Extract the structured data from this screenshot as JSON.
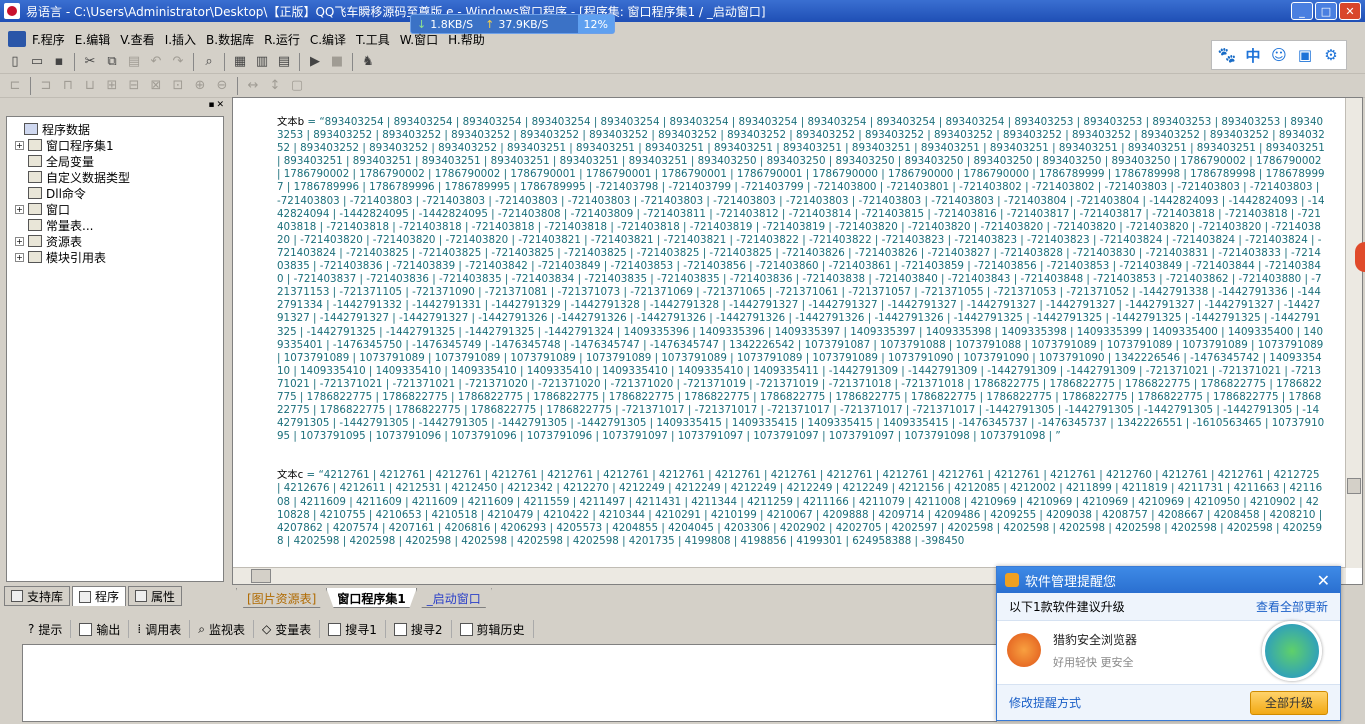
{
  "window": {
    "title": "易语言 - C:\\Users\\Administrator\\Desktop\\【正版】QQ飞车瞬移源码至尊版.e - Windows窗口程序 - [程序集: 窗口程序集1 / _启动窗口]",
    "min": "_",
    "max": "□",
    "close": "✕"
  },
  "netspeed": {
    "down": "1.8KB/S",
    "up": "37.9KB/S",
    "percent": "12%"
  },
  "menu": [
    "F.程序",
    "E.编辑",
    "V.查看",
    "I.插入",
    "B.数据库",
    "R.运行",
    "C.编译",
    "T.工具",
    "W.窗口",
    "H.帮助"
  ],
  "right_icons": [
    "paw-icon",
    "zh-icon",
    "smile-icon",
    "image-icon",
    "gear-icon"
  ],
  "right_icon_glyphs": [
    "🐾",
    "中",
    "☺",
    "▣",
    "⚙"
  ],
  "tree": {
    "items": [
      {
        "label": "程序数据",
        "level": 0,
        "expander": ""
      },
      {
        "label": "窗口程序集1",
        "level": 1,
        "expander": "+"
      },
      {
        "label": "全局变量",
        "level": 1,
        "expander": ""
      },
      {
        "label": "自定义数据类型",
        "level": 1,
        "expander": ""
      },
      {
        "label": "Dll命令",
        "level": 1,
        "expander": ""
      },
      {
        "label": "窗口",
        "level": 1,
        "expander": "+"
      },
      {
        "label": "常量表...",
        "level": 1,
        "expander": ""
      },
      {
        "label": "资源表",
        "level": 1,
        "expander": "+"
      },
      {
        "label": "模块引用表",
        "level": 1,
        "expander": "+"
      }
    ]
  },
  "left_tabs": [
    "支持库",
    "程序",
    "属性"
  ],
  "code": {
    "block_b_label": "文本b",
    "block_b": "= “893403254 | 893403254 | 893403254 | 893403254 | 893403254 | 893403254 | 893403254 | 893403254 | 893403254 | 893403254 | 893403253 | 893403253 | 893403253 | 893403253 | 893403253 | 893403252 | 893403252 | 893403252 | 893403252 | 893403252 | 893403252 | 893403252 | 893403252 | 893403252 | 893403252 | 893403252 | 893403252 | 893403252 | 893403252 | 893403252 | 893403252 | 893403252 | 893403252 | 893403251 | 893403251 | 893403251 | 893403251 | 893403251 | 893403251 | 893403251 | 893403251 | 893403251 | 893403251 | 893403251 | 893403251 | 893403251 | 893403251 | 893403251 | 893403251 | 893403251 | 893403251 | 893403250 | 893403250 | 893403250 | 893403250 | 893403250 | 893403250 | 893403250 | 1786790002 | 1786790002 | 1786790002 | 1786790002 | 1786790002 | 1786790001 | 1786790001 | 1786790001 | 1786790001 | 1786790000 | 1786790000 | 1786790000 | 1786789999 | 1786789998 | 1786789998 | 1786789997 | 1786789996 | 1786789996 | 1786789995 | 1786789995 | -721403798 | -721403799 | -721403799 | -721403800 | -721403801 | -721403802 | -721403802 | -721403803 | -721403803 | -721403803 | -721403803 | -721403803 | -721403803 | -721403803 | -721403803 | -721403803 | -721403803 | -721403803 | -721403803 | -721403803 | -721403804 | -721403804 | -1442824093 | -1442824093 | -1442824094 | -1442824095 | -1442824095 | -721403808 | -721403809 | -721403811 | -721403812 | -721403814 | -721403815 | -721403816 | -721403817 | -721403817 | -721403818 | -721403818 | -721403818 | -721403818 | -721403818 | -721403818 | -721403818 | -721403818 | -721403819 | -721403819 | -721403820 | -721403820 | -721403820 | -721403820 | -721403820 | -721403820 | -721403820 | -721403820 | -721403820 | -721403820 | -721403821 | -721403821 | -721403821 | -721403822 | -721403822 | -721403823 | -721403823 | -721403823 | -721403824 | -721403824 | -721403824 | -721403824 | -721403825 | -721403825 | -721403825 | -721403825 | -721403825 | -721403825 | -721403826 | -721403826 | -721403827 | -721403828 | -721403830 | -721403831 | -721403833 | -721403835 | -721403836 | -721403839 | -721403842 | -721403849 | -721403853 | -721403856 | -721403860 | -721403861 | -721403859 | -721403856 | -721403853 | -721403849 | -721403844 | -721403840 | -721403837 | -721403836 | -721403835 | -721403834 | -721403835 | -721403835 | -721403836 | -721403838 | -721403840 | -721403843 | -721403848 | -721403853 | -721403862 | -721403880 | -721371153 | -721371105 | -721371090 | -721371081 | -721371073 | -721371069 | -721371065 | -721371061 | -721371057 | -721371055 | -721371053 | -721371052 | -1442791338 | -1442791336 | -1442791334 | -1442791332 | -1442791331 | -1442791329 | -1442791328 | -1442791328 | -1442791327 | -1442791327 | -1442791327 | -1442791327 | -1442791327 | -1442791327 | -1442791327 | -1442791327 | -1442791327 | -1442791327 | -1442791326 | -1442791326 | -1442791326 | -1442791326 | -1442791326 | -1442791326 | -1442791325 | -1442791325 | -1442791325 | -1442791325 | -1442791325 | -1442791325 | -1442791325 | -1442791325 | -1442791324 | 1409335396 | 1409335396 | 1409335397 | 1409335397 | 1409335398 | 1409335398 | 1409335399 | 1409335400 | 1409335400 | 1409335401 | -1476345750 | -1476345749 | -1476345748 | -1476345747 | -1476345747 | 1342226542 | 1073791087 | 1073791088 | 1073791088 | 1073791089 | 1073791089 | 1073791089 | 1073791089 | 1073791089 | 1073791089 | 1073791089 | 1073791089 | 1073791089 | 1073791089 | 1073791089 | 1073791089 | 1073791090 | 1073791090 | 1073791090 | 1342226546 | -1476345742 | 1409335410 | 1409335410 | 1409335410 | 1409335410 | 1409335410 | 1409335410 | 1409335410 | 1409335411 | -1442791309 | -1442791309 | -1442791309 | -1442791309 | -721371021 | -721371021 | -721371021 | -721371021 | -721371021 | -721371020 | -721371020 | -721371020 | -721371019 | -721371019 | -721371018 | -721371018 | 1786822775 | 1786822775 | 1786822775 | 1786822775 | 1786822775 | 1786822775 | 1786822775 | 1786822775 | 1786822775 | 1786822775 | 1786822775 | 1786822775 | 1786822775 | 1786822775 | 1786822775 | 1786822775 | 1786822775 | 1786822775 | 1786822775 | 1786822775 | 1786822775 | 1786822775 | 1786822775 | -721371017 | -721371017 | -721371017 | -721371017 | -721371017 | -1442791305 | -1442791305 | -1442791305 | -1442791305 | -1442791305 | -1442791305 | -1442791305 | -1442791305 | -1442791305 | 1409335415 | 1409335415 | 1409335415 | 1409335415 | -1476345737 | -1476345737 | 1342226551 | -1610563465 | 1073791095 | 1073791095 | 1073791096 | 1073791096 | 1073791096 | 1073791097 | 1073791097 | 1073791097 | 1073791097 | 1073791098 | 1073791098 | ”",
    "block_c_label": "文本c",
    "block_c": "= “4212761 | 4212761 | 4212761 | 4212761 | 4212761 | 4212761 | 4212761 | 4212761 | 4212761 | 4212761 | 4212761 | 4212761 | 4212761 | 4212761 | 4212760 | 4212761 | 4212761 | 4212725 | 4212676 | 4212611 | 4212531 | 4212450 | 4212342 | 4212270 | 4212249 | 4212249 | 4212249 | 4212249 | 4212249 | 4212156 | 4212085 | 4212002 | 4211899 | 4211819 | 4211731 | 4211663 | 4211608 | 4211609 | 4211609 | 4211609 | 4211609 | 4211559 | 4211497 | 4211431 | 4211344 | 4211259 | 4211166 | 4211079 | 4211008 | 4210969 | 4210969 | 4210969 | 4210969 | 4210950 | 4210902 | 4210828 | 4210755 | 4210653 | 4210518 | 4210479 | 4210422 | 4210344 | 4210291 | 4210199 | 4210067 | 4209888 | 4209714 | 4209486 | 4209255 | 4209038 | 4208757 | 4208667 | 4208458 | 4208210 | 4207862 | 4207574 | 4207161 | 4206816 | 4206293 | 4205573 | 4204855 | 4204045 | 4203306 | 4202902 | 4202705 | 4202597 | 4202598 | 4202598 | 4202598 | 4202598 | 4202598 | 4202598 | 4202598 | 4202598 | 4202598 | 4202598 | 4202598 | 4202598 | 4202598 | 4201735 | 4199808 | 4198856 | 4199301 | 624958388 | -398450"
  },
  "editor_tabs": [
    "[图片资源表]",
    "窗口程序集1",
    "_启动窗口"
  ],
  "bottom_tabs": [
    "提示",
    "输出",
    "调用表",
    "监视表",
    "变量表",
    "搜寻1",
    "搜寻2",
    "剪辑历史"
  ],
  "popup": {
    "title": "软件管理提醒您",
    "subtitle": "以下1款软件建议升级",
    "view_all": "查看全部更新",
    "app_name": "猎豹安全浏览器",
    "app_desc": "好用轻快 更安全",
    "modify": "修改提醒方式",
    "upgrade_all": "全部升级",
    "close": "✕"
  }
}
